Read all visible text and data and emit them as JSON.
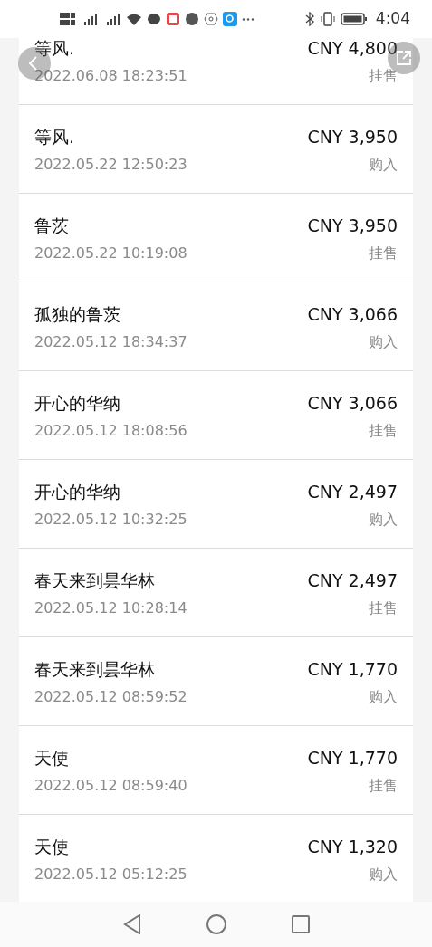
{
  "status_bar": {
    "time": "4:04"
  },
  "transactions": [
    {
      "name": "等风.",
      "amount": "CNY 4,800",
      "time": "2022.06.08 18:23:51",
      "type": "挂售"
    },
    {
      "name": "等风.",
      "amount": "CNY 3,950",
      "time": "2022.05.22 12:50:23",
      "type": "购入"
    },
    {
      "name": "鲁茨",
      "amount": "CNY 3,950",
      "time": "2022.05.22 10:19:08",
      "type": "挂售"
    },
    {
      "name": "孤独的鲁茨",
      "amount": "CNY 3,066",
      "time": "2022.05.12 18:34:37",
      "type": "购入"
    },
    {
      "name": "开心的华纳",
      "amount": "CNY 3,066",
      "time": "2022.05.12 18:08:56",
      "type": "挂售"
    },
    {
      "name": "开心的华纳",
      "amount": "CNY 2,497",
      "time": "2022.05.12 10:32:25",
      "type": "购入"
    },
    {
      "name": "春天来到昙华林",
      "amount": "CNY 2,497",
      "time": "2022.05.12 10:28:14",
      "type": "挂售"
    },
    {
      "name": "春天来到昙华林",
      "amount": "CNY 1,770",
      "time": "2022.05.12 08:59:52",
      "type": "购入"
    },
    {
      "name": "天使",
      "amount": "CNY 1,770",
      "time": "2022.05.12 08:59:40",
      "type": "挂售"
    },
    {
      "name": "天使",
      "amount": "CNY 1,320",
      "time": "2022.05.12 05:12:25",
      "type": "购入"
    }
  ]
}
